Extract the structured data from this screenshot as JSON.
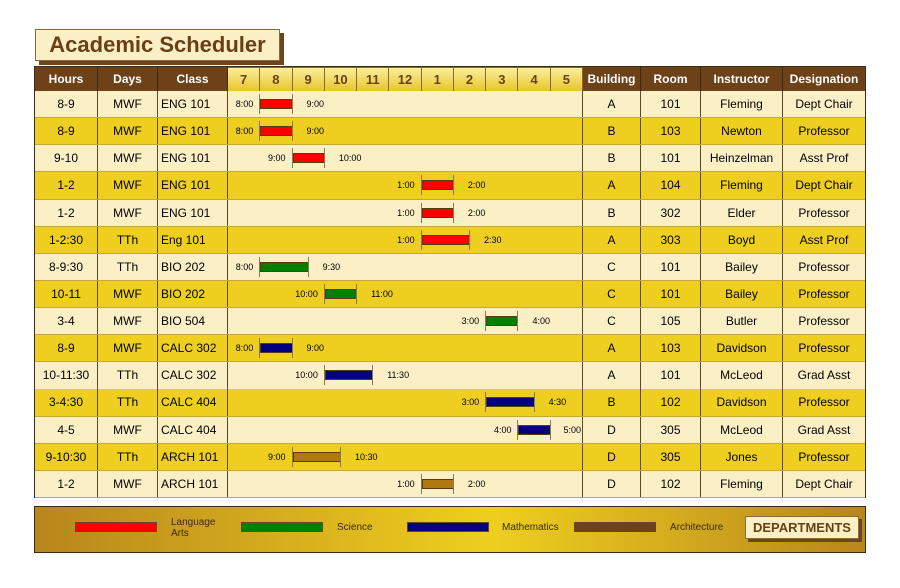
{
  "title": "Academic Scheduler",
  "headers": {
    "hours": "Hours",
    "days": "Days",
    "class": "Class",
    "timeline": [
      "7",
      "8",
      "9",
      "10",
      "11",
      "12",
      "1",
      "2",
      "3",
      "4",
      "5"
    ],
    "building": "Building",
    "room": "Room",
    "instructor": "Instructor",
    "designation": "Designation"
  },
  "departments": {
    "language_arts": {
      "label": "Language Arts",
      "color": "#ff0000"
    },
    "science": {
      "label": "Science",
      "color": "#008000"
    },
    "mathematics": {
      "label": "Mathematics",
      "color": "#000080"
    },
    "architecture": {
      "label": "Architecture",
      "color": "#6e4218",
      "bar_color": "#b07810"
    }
  },
  "legend_title": "DEPARTMENTS",
  "rows": [
    {
      "hours": "8-9",
      "days": "MWF",
      "class": "ENG 101",
      "start": 8,
      "end": 9,
      "start_label": "8:00",
      "end_label": "9:00",
      "dept": "language_arts",
      "building": "A",
      "room": "101",
      "instructor": "Fleming",
      "designation": "Dept Chair"
    },
    {
      "hours": "8-9",
      "days": "MWF",
      "class": "ENG 101",
      "start": 8,
      "end": 9,
      "start_label": "8:00",
      "end_label": "9:00",
      "dept": "language_arts",
      "building": "B",
      "room": "103",
      "instructor": "Newton",
      "designation": "Professor"
    },
    {
      "hours": "9-10",
      "days": "MWF",
      "class": "ENG 101",
      "start": 9,
      "end": 10,
      "start_label": "9:00",
      "end_label": "10:00",
      "dept": "language_arts",
      "building": "B",
      "room": "101",
      "instructor": "Heinzelman",
      "designation": "Asst Prof"
    },
    {
      "hours": "1-2",
      "days": "MWF",
      "class": "ENG 101",
      "start": 13,
      "end": 14,
      "start_label": "1:00",
      "end_label": "2:00",
      "dept": "language_arts",
      "building": "A",
      "room": "104",
      "instructor": "Fleming",
      "designation": "Dept Chair"
    },
    {
      "hours": "1-2",
      "days": "MWF",
      "class": "ENG 101",
      "start": 13,
      "end": 14,
      "start_label": "1:00",
      "end_label": "2:00",
      "dept": "language_arts",
      "building": "B",
      "room": "302",
      "instructor": "Elder",
      "designation": "Professor"
    },
    {
      "hours": "1-2:30",
      "days": "TTh",
      "class": "Eng 101",
      "start": 13,
      "end": 14.5,
      "start_label": "1:00",
      "end_label": "2:30",
      "dept": "language_arts",
      "building": "A",
      "room": "303",
      "instructor": "Boyd",
      "designation": "Asst Prof"
    },
    {
      "hours": "8-9:30",
      "days": "TTh",
      "class": "BIO 202",
      "start": 8,
      "end": 9.5,
      "start_label": "8:00",
      "end_label": "9:30",
      "dept": "science",
      "building": "C",
      "room": "101",
      "instructor": "Bailey",
      "designation": "Professor"
    },
    {
      "hours": "10-11",
      "days": "MWF",
      "class": "BIO 202",
      "start": 10,
      "end": 11,
      "start_label": "10:00",
      "end_label": "11:00",
      "dept": "science",
      "building": "C",
      "room": "101",
      "instructor": "Bailey",
      "designation": "Professor"
    },
    {
      "hours": "3-4",
      "days": "MWF",
      "class": "BIO 504",
      "start": 15,
      "end": 16,
      "start_label": "3:00",
      "end_label": "4:00",
      "dept": "science",
      "building": "C",
      "room": "105",
      "instructor": "Butler",
      "designation": "Professor"
    },
    {
      "hours": "8-9",
      "days": "MWF",
      "class": "CALC 302",
      "start": 8,
      "end": 9,
      "start_label": "8:00",
      "end_label": "9:00",
      "dept": "mathematics",
      "building": "A",
      "room": "103",
      "instructor": "Davidson",
      "designation": "Professor"
    },
    {
      "hours": "10-11:30",
      "days": "TTh",
      "class": "CALC 302",
      "start": 10,
      "end": 11.5,
      "start_label": "10:00",
      "end_label": "11:30",
      "dept": "mathematics",
      "building": "A",
      "room": "101",
      "instructor": "McLeod",
      "designation": "Grad Asst"
    },
    {
      "hours": "3-4:30",
      "days": "TTh",
      "class": "CALC 404",
      "start": 15,
      "end": 16.5,
      "start_label": "3:00",
      "end_label": "4:30",
      "dept": "mathematics",
      "building": "B",
      "room": "102",
      "instructor": "Davidson",
      "designation": "Professor"
    },
    {
      "hours": "4-5",
      "days": "MWF",
      "class": "CALC 404",
      "start": 16,
      "end": 17,
      "start_label": "4:00",
      "end_label": "5:00",
      "dept": "mathematics",
      "building": "D",
      "room": "305",
      "instructor": "McLeod",
      "designation": "Grad Asst"
    },
    {
      "hours": "9-10:30",
      "days": "TTh",
      "class": "ARCH 101",
      "start": 9,
      "end": 10.5,
      "start_label": "9:00",
      "end_label": "10:30",
      "dept": "architecture",
      "building": "D",
      "room": "305",
      "instructor": "Jones",
      "designation": "Professor"
    },
    {
      "hours": "1-2",
      "days": "MWF",
      "class": "ARCH 101",
      "start": 13,
      "end": 14,
      "start_label": "1:00",
      "end_label": "2:00",
      "dept": "architecture",
      "building": "D",
      "room": "102",
      "instructor": "Fleming",
      "designation": "Dept Chair"
    }
  ]
}
